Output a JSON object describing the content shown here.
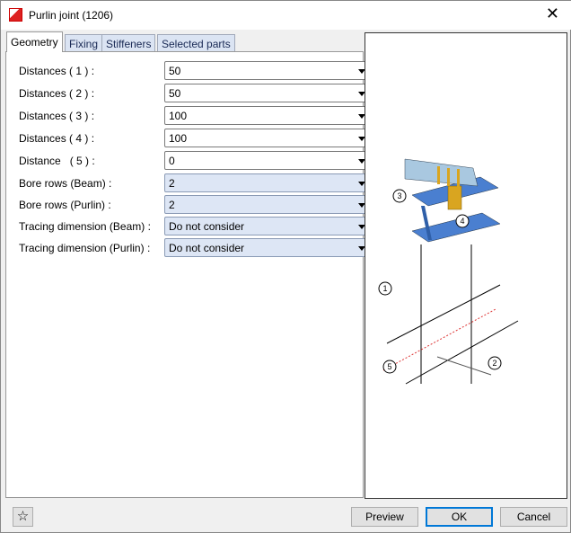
{
  "window": {
    "title": "Purlin joint (1206)"
  },
  "tabs": [
    {
      "label": "Geometry"
    },
    {
      "label": "Fixing"
    },
    {
      "label": "Stiffeners"
    },
    {
      "label": "Selected parts"
    }
  ],
  "fields": [
    {
      "label": "Distances ( 1 ) :",
      "value": "50"
    },
    {
      "label": "Distances ( 2 ) :",
      "value": "50"
    },
    {
      "label": "Distances ( 3 ) :",
      "value": "100"
    },
    {
      "label": "Distances ( 4 ) :",
      "value": "100"
    },
    {
      "label": "Distance   ( 5 ) :",
      "value": "0"
    },
    {
      "label": "Bore rows (Beam) :",
      "value": "2"
    },
    {
      "label": "Bore rows (Purlin) :",
      "value": "2"
    },
    {
      "label": "Tracing dimension (Beam) :",
      "value": "Do not consider"
    },
    {
      "label": "Tracing dimension (Purlin) :",
      "value": "Do not consider"
    }
  ],
  "diagram": {
    "callouts": [
      "1",
      "2",
      "3",
      "4",
      "5"
    ]
  },
  "buttons": {
    "preview": "Preview",
    "ok": "OK",
    "cancel": "Cancel"
  }
}
